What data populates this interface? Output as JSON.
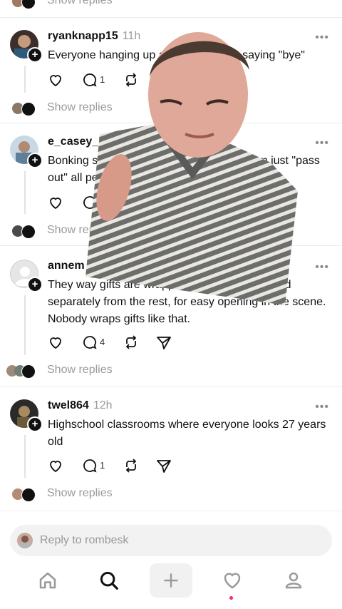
{
  "feed": {
    "show_replies_label": "Show replies",
    "top_show_replies": "Show replies",
    "posts": [
      {
        "username": "ryanknapp15",
        "time": "11h",
        "text": "Everyone hanging up a phone without saying \"bye\"",
        "replies": "1",
        "show_replies": "Show replies"
      },
      {
        "username": "e_casey_le",
        "time": "",
        "text": "Bonking someone on the head makes them just \"pass out\" all peacefully",
        "replies": "",
        "show_replies": "Show replies"
      },
      {
        "username": "annem",
        "time": "",
        "text": "They way gifts are wrapped with the lid wrapped separately from the rest, for easy opening in the scene.  Nobody wraps gifts like that.",
        "replies": "4",
        "show_replies": "Show replies"
      },
      {
        "username": "twel864",
        "time": "12h",
        "text": "Highschool classrooms where everyone looks 27 years old",
        "replies": "1",
        "show_replies": "Show replies"
      }
    ]
  },
  "composer": {
    "placeholder": "Reply to rombesk"
  },
  "icons": {
    "like": "heart-icon",
    "reply": "comment-icon",
    "repost": "repost-icon",
    "share": "send-icon",
    "nav": [
      "home-icon",
      "search-icon",
      "plus-icon",
      "heart-icon",
      "profile-icon"
    ]
  },
  "colors": {
    "notification_dot": "#ff2b5a",
    "muted": "#9a9a9a"
  }
}
